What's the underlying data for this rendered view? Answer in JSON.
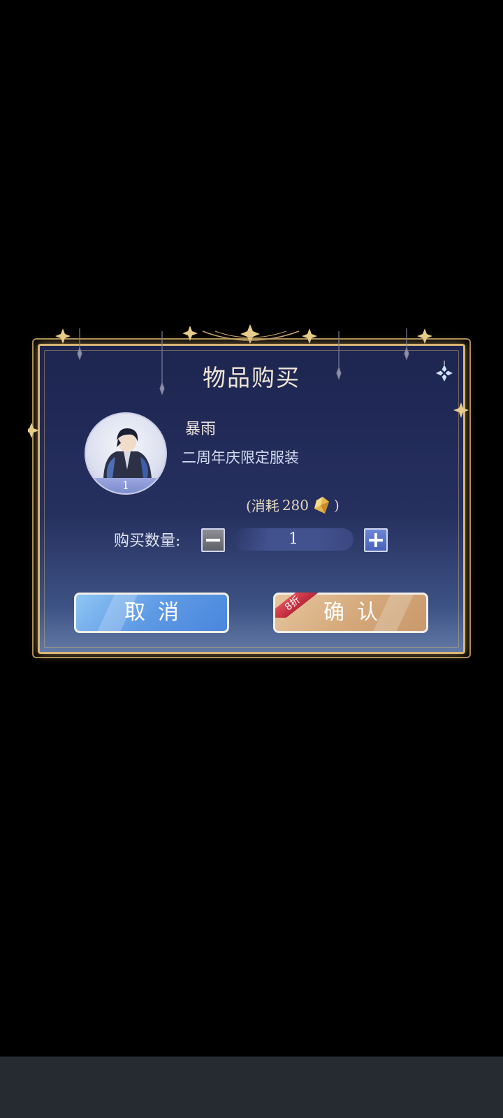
{
  "dialog": {
    "title": "物品购买",
    "close_icon": "close-sparkle-icon"
  },
  "item": {
    "name": "暴雨",
    "description": "二周年庆限定服装",
    "owned_count": "1",
    "image_icon": "character-portrait-icon"
  },
  "cost": {
    "prefix": "(消耗",
    "amount": "280",
    "suffix": ")",
    "currency_icon": "gold-crystal-icon"
  },
  "quantity": {
    "label": "购买数量:",
    "value": "1",
    "minus_icon": "minus-icon",
    "plus_icon": "plus-icon"
  },
  "buttons": {
    "cancel_label": "取消",
    "confirm_label": "确认",
    "discount_badge": "8折"
  },
  "colors": {
    "panel_top": "#1d2550",
    "panel_bottom": "#6279a5",
    "gold_border": "#d9b574",
    "cancel_blue": "#5f9ae5",
    "confirm_tan": "#d4a87a",
    "discount_red": "#c83040"
  }
}
